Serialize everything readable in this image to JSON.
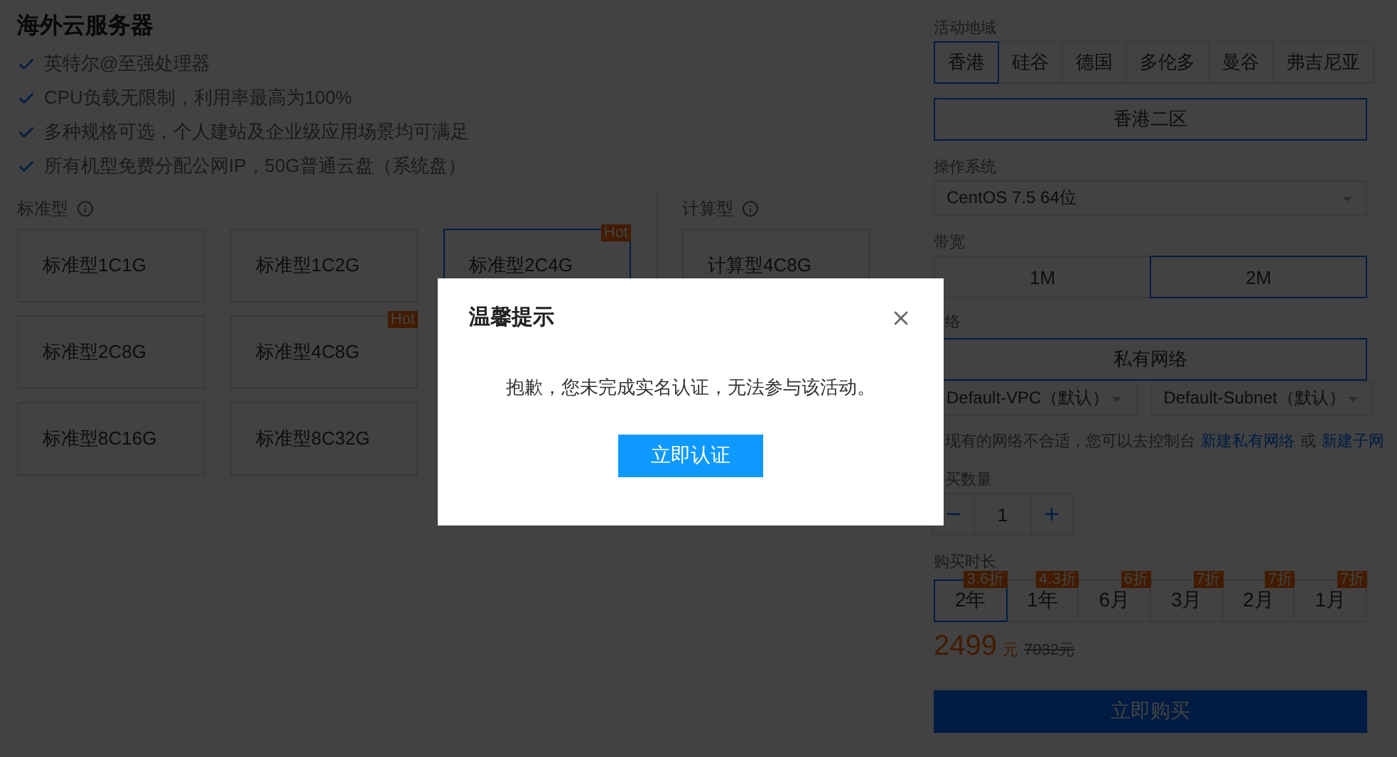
{
  "page": {
    "title": "海外云服务器",
    "features": [
      "英特尔@至强处理器",
      "CPU负载无限制，利用率最高为100%",
      "多种规格可选，个人建站及企业级应用场景均可满足",
      "所有机型免费分配公网IP，50G普通云盘（系统盘）"
    ],
    "standard": {
      "label": "标准型",
      "rows": [
        [
          {
            "name": "标准型1C1G",
            "selected": false
          },
          {
            "name": "标准型1C2G",
            "selected": false
          },
          {
            "name": "标准型2C4G",
            "selected": true,
            "badge": "Hot"
          }
        ],
        [
          {
            "name": "标准型2C8G",
            "selected": false
          },
          {
            "name": "标准型4C8G",
            "selected": false,
            "badge": "Hot"
          }
        ],
        [
          {
            "name": "标准型8C16G",
            "selected": false
          },
          {
            "name": "标准型8C32G",
            "selected": false
          }
        ]
      ]
    },
    "compute": {
      "label": "计算型",
      "plans": [
        {
          "name": "计算型4C8G",
          "selected": false
        }
      ]
    }
  },
  "order": {
    "region": {
      "label": "活动地域",
      "options": [
        {
          "label": "香港",
          "selected": true
        },
        {
          "label": "硅谷",
          "selected": false
        },
        {
          "label": "德国",
          "selected": false
        },
        {
          "label": "多伦多",
          "selected": false
        },
        {
          "label": "曼谷",
          "selected": false
        },
        {
          "label": "弗吉尼亚",
          "selected": false
        }
      ],
      "zones": [
        {
          "label": "香港二区",
          "selected": true
        }
      ]
    },
    "os": {
      "label": "操作系统",
      "value": "CentOS 7.5 64位"
    },
    "bandwidth": {
      "label": "带宽",
      "options": [
        {
          "label": "1M",
          "selected": false
        },
        {
          "label": "2M",
          "selected": true
        }
      ]
    },
    "network": {
      "label": "络",
      "options": [
        {
          "label": "私有网络",
          "selected": true
        }
      ],
      "vpc": "Default-VPC（默认）",
      "subnet": "Default-Subnet（默认）",
      "hint": "现有的网络不合适，您可以去控制台",
      "links": [
        "新建私有网络",
        "新建子网"
      ],
      "joiner": "或"
    },
    "quantity": {
      "label": "买数量",
      "value": "1"
    },
    "duration": {
      "label": "购买时长",
      "options": [
        {
          "label": "2年",
          "discount": "3.6折",
          "selected": true
        },
        {
          "label": "1年",
          "discount": "4.3折",
          "selected": false
        },
        {
          "label": "6月",
          "discount": "6折",
          "selected": false
        },
        {
          "label": "3月",
          "discount": "7折",
          "selected": false
        },
        {
          "label": "2月",
          "discount": "7折",
          "selected": false
        },
        {
          "label": "1月",
          "discount": "7折",
          "selected": false
        }
      ]
    },
    "price": {
      "amount": "2499",
      "unit": "元",
      "original": "7032元"
    },
    "buy_button": "立即购买"
  },
  "dialog": {
    "title": "温馨提示",
    "message": "抱歉，您未完成实名认证，无法参与该活动。",
    "button": "立即认证"
  }
}
